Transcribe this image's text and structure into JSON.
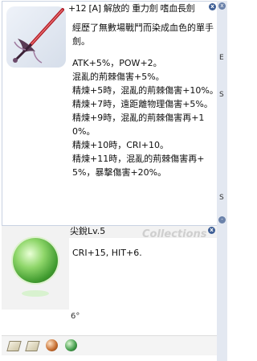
{
  "item": {
    "title": "+12 [A] 解放的 重力劍 嗜血長劍",
    "description": [
      "經歷了無數場戰鬥而染成血色的單手劍。",
      "",
      "ATK+5%，POW+2。",
      "混亂的荊棘傷害+5%。",
      "精煉+5時，混亂的荊棘傷害+10%。",
      "精煉+7時，遠距離物理傷害+5%。",
      "精煉+9時，混亂的荊棘傷害再+10%。",
      "精煉+10時，CRI+10。",
      "精煉+11時，混亂的荊棘傷害再+5%，暴擊傷害+20%。"
    ],
    "close_label": "x"
  },
  "card": {
    "name": "尖銳Lv.5",
    "watermark": "Collections",
    "effect": "CRI+15, HIT+6.",
    "close_label": "x"
  },
  "footer_text": "6°",
  "side_strip": {
    "letters": [
      "E",
      "S",
      "S"
    ]
  },
  "slots": [
    "card-slot",
    "card-slot",
    "orange-orb",
    "green-orb"
  ]
}
